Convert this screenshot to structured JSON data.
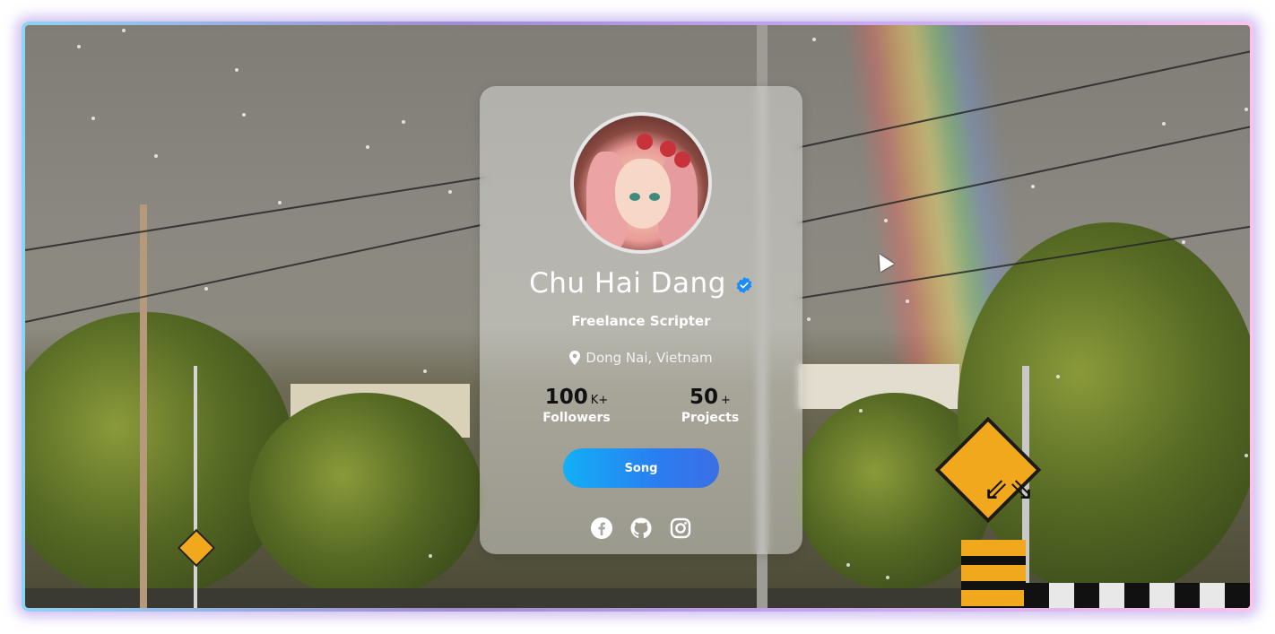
{
  "profile": {
    "name": "Chu Hai Dang",
    "verified": true,
    "role": "Freelance Scripter",
    "location": "Dong Nai, Vietnam",
    "stats": [
      {
        "value": "100",
        "suffix": "K+",
        "label": "Followers"
      },
      {
        "value": "50",
        "suffix": "+",
        "label": "Projects"
      }
    ],
    "song_button": "Song",
    "socials": [
      "facebook-icon",
      "github-icon",
      "instagram-icon"
    ]
  },
  "colors": {
    "frame_gradient": [
      "#8fd3f4",
      "#a18cd1",
      "#fbc2eb"
    ],
    "button_gradient": [
      "#12b0f7",
      "#3b6ee6"
    ],
    "verified_badge": "#1d8cf8"
  }
}
